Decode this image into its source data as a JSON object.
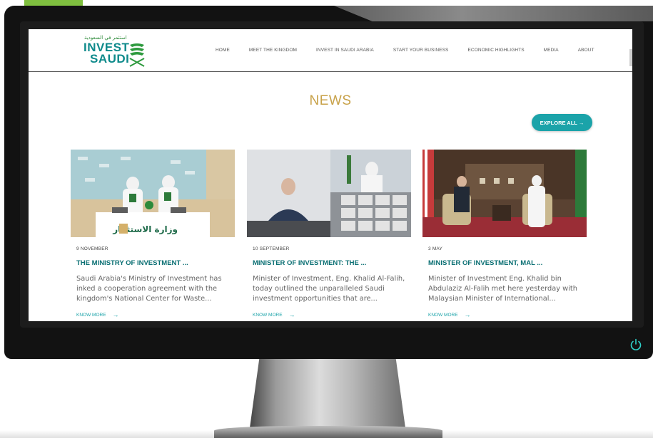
{
  "site": {
    "logo": {
      "arabic": "استثمر في السعودية",
      "line1": "INVEST",
      "line2": "SAUDI"
    },
    "nav": [
      "HOME",
      "MEET THE KINGDOM",
      "INVEST IN SAUDI ARABIA",
      "START YOUR BUSINESS",
      "ECONOMIC HIGHLIGHTS",
      "MEDIA",
      "ABOUT"
    ],
    "section_title": "NEWS",
    "explore_label": "EXPLORE ALL →",
    "cards": [
      {
        "date": "9 NOVEMBER",
        "headline": "THE MINISTRY OF INVESTMENT ...",
        "excerpt": "Saudi Arabia's Ministry of Investment has inked a cooperation agreement with the kingdom's National Center for Waste...",
        "link": "KNOW MORE",
        "image_sign": "وزارة الاستثمار",
        "image": "signing-ceremony"
      },
      {
        "date": "10 SEPTEMBER",
        "headline": "MINISTER OF INVESTMENT: THE ...",
        "excerpt": "Minister of Investment, Eng. Khalid Al-Falih, today outlined the unparalleled Saudi investment opportunities that are...",
        "link": "KNOW MORE",
        "image": "video-conference"
      },
      {
        "date": "3 MAY",
        "headline": "MINISTER OF INVESTMENT, MAL ...",
        "excerpt": "Minister of Investment Eng. Khalid bin Abdulaziz Al-Falih met here yesterday with Malaysian Minister of International...",
        "link": "KNOW MORE",
        "image": "bilateral-meeting"
      }
    ]
  },
  "colors": {
    "brand_teal": "#0e8a8b",
    "accent_teal": "#1ba3a9",
    "news_gold": "#c8a24a",
    "monitor": "#121212"
  },
  "icons": [
    "power-icon",
    "arrow-right-icon",
    "logo-mark-icon"
  ]
}
